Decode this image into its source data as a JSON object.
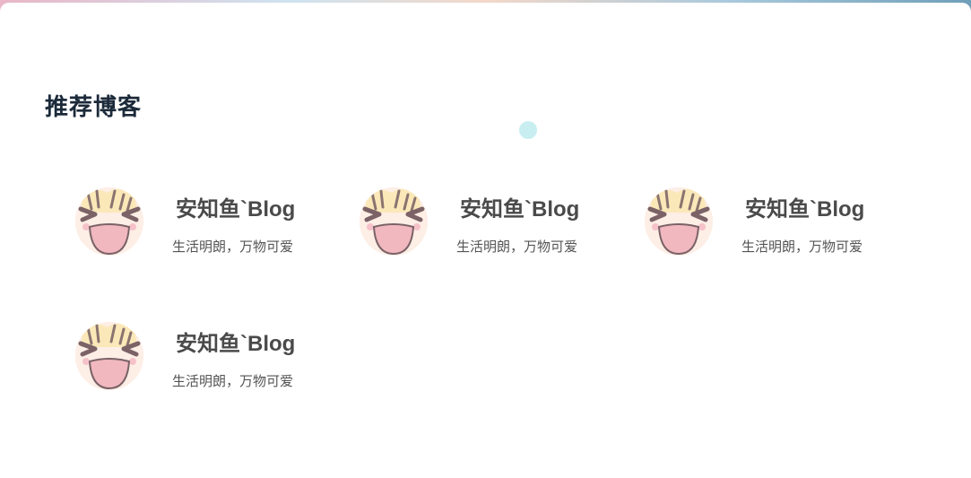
{
  "section": {
    "title": "推荐博客"
  },
  "blogs": [
    {
      "name": "安知鱼`Blog",
      "description": "生活明朗，万物可爱",
      "avatar_icon": "anime-laughing-face-avatar"
    },
    {
      "name": "安知鱼`Blog",
      "description": "生活明朗，万物可爱",
      "avatar_icon": "anime-laughing-face-avatar"
    },
    {
      "name": "安知鱼`Blog",
      "description": "生活明朗，万物可爱",
      "avatar_icon": "anime-laughing-face-avatar"
    },
    {
      "name": "安知鱼`Blog",
      "description": "生活明朗，万物可爱",
      "avatar_icon": "anime-laughing-face-avatar"
    }
  ],
  "colors": {
    "title": "#1c2a3a",
    "name": "#4a4a4a",
    "desc": "#555555",
    "dot": "#c9eef1"
  }
}
